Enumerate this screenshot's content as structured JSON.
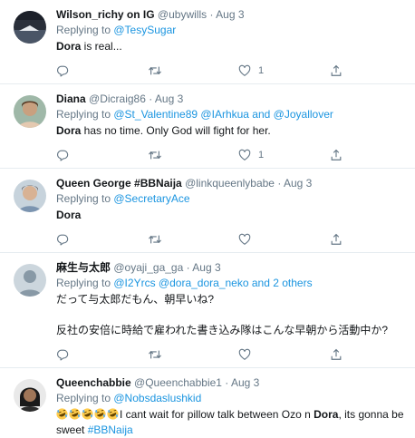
{
  "tweets": [
    {
      "name": "Wilson_richy on IG",
      "handle": "@ubywills",
      "sep": "·",
      "date": "Aug 3",
      "replying_prefix": "Replying to ",
      "replying_to": "@TesySugar",
      "text_bold": "Dora",
      "text_rest": " is real...",
      "like_count": "1",
      "avatar_icon": "dark-scene-avatar"
    },
    {
      "name": "Diana",
      "handle": "@Dicraig86",
      "sep": "·",
      "date": "Aug 3",
      "replying_prefix": "Replying to ",
      "replying_to_1": "@St_Valentine89",
      "replying_to_2": "@IArhkua",
      "replying_and": " and ",
      "replying_to_3": "@Joyallover",
      "text_bold": "Dora",
      "text_rest": " has no time. Only God will fight for her.",
      "like_count": "1",
      "avatar_icon": "woman-photo-avatar"
    },
    {
      "name": "Queen George #BBNaija",
      "handle": "@linkqueenlybabe",
      "sep": "·",
      "date": "Aug 3",
      "replying_prefix": "Replying to ",
      "replying_to": "@SecretaryAce",
      "text_bold": "Dora",
      "avatar_icon": "woman-photo-avatar"
    },
    {
      "name": "麻生与太郎",
      "handle": "@oyaji_ga_ga",
      "sep": "·",
      "date": "Aug 3",
      "replying_prefix": "Replying to ",
      "replying_to_1": "@I2Yrcs",
      "replying_to_2": "@dora_dora_neko",
      "replying_and": " and ",
      "replying_others": "2 others",
      "line1": "だって与太郎だもん、朝早いね?",
      "line2": "反社の安倍に時給で雇われた書き込み隊はこんな早朝から活動中か?",
      "avatar_icon": "default-profile-avatar"
    },
    {
      "name": "Queenchabbie",
      "handle": "@Queenchabbie1",
      "sep": "·",
      "date": "Aug 3",
      "replying_prefix": "Replying to ",
      "replying_to": "@Nobsdaslushkid",
      "emoji_name": "rolling-on-floor-laughing-emoji",
      "text_a": "I cant wait for pillow talk between Ozo n ",
      "text_bold": "Dora",
      "text_b": ", its gonna be sweet ",
      "hashtag": "#BBNaija",
      "avatar_icon": "woman-portrait-avatar"
    }
  ],
  "colors": {
    "link": "#1b95e0",
    "muted": "#657786",
    "border": "#e6ecf0",
    "text": "#14171a"
  },
  "icons": [
    "reply-icon",
    "retweet-icon",
    "like-icon",
    "share-icon"
  ]
}
